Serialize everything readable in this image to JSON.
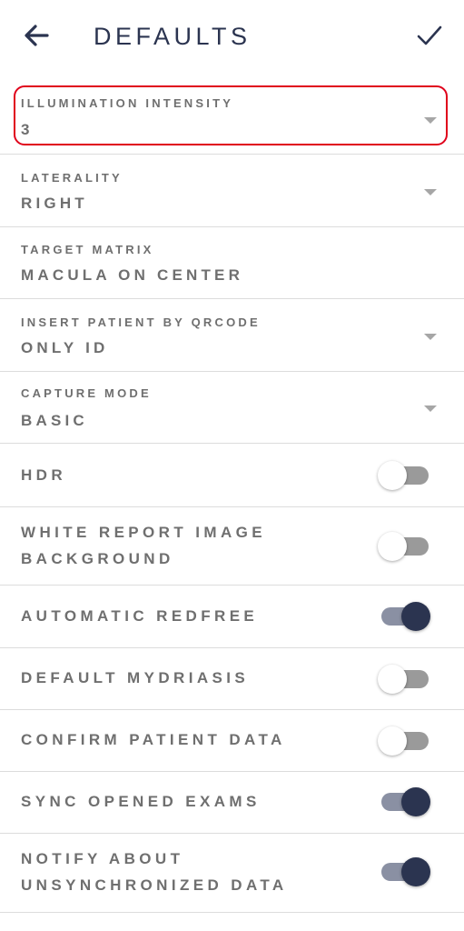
{
  "header": {
    "title": "DEFAULTS",
    "back_icon": "arrow-left-icon",
    "confirm_icon": "check-icon"
  },
  "fields": {
    "illumination": {
      "label": "ILLUMINATION INTENSITY",
      "value": "3"
    },
    "laterality": {
      "label": "LATERALITY",
      "value": "RIGHT"
    },
    "target_matrix": {
      "label": "TARGET MATRIX",
      "value": "MACULA ON CENTER"
    },
    "insert_patient": {
      "label": "INSERT PATIENT BY QRCODE",
      "value": "ONLY ID"
    },
    "capture_mode": {
      "label": "CAPTURE MODE",
      "value": "BASIC"
    }
  },
  "toggles": {
    "hdr": {
      "label": "HDR",
      "on": false
    },
    "white_report": {
      "line1": "WHITE REPORT IMAGE",
      "line2": "BACKGROUND",
      "on": false
    },
    "automatic_redfree": {
      "label": "AUTOMATIC REDFREE",
      "on": true
    },
    "default_mydriasis": {
      "label": "DEFAULT MYDRIASIS",
      "on": false
    },
    "confirm_patient": {
      "label": "CONFIRM PATIENT DATA",
      "on": false
    },
    "sync_opened": {
      "label": "SYNC OPENED EXAMS",
      "on": true
    },
    "notify_unsync": {
      "line1": "NOTIFY ABOUT",
      "line2": "UNSYNCHRONIZED DATA",
      "on": true
    }
  },
  "colors": {
    "primary": "#2b3450",
    "highlight": "#e0001b",
    "text": "#6f6f6f"
  }
}
